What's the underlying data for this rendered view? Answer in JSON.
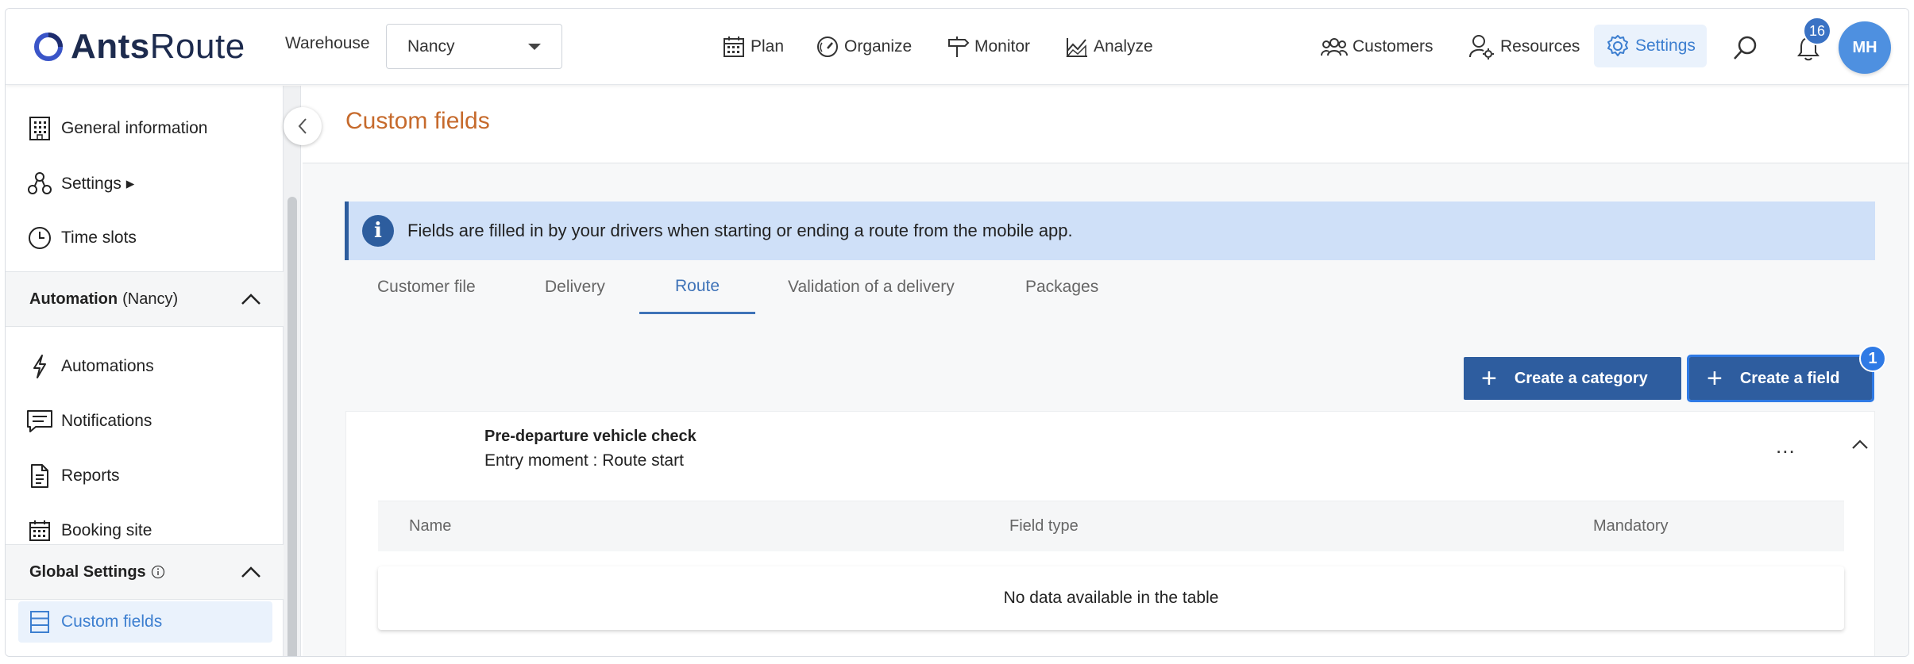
{
  "app": {
    "logo_bold": "Ants",
    "logo_light": "Route"
  },
  "header": {
    "warehouse_label": "Warehouse",
    "warehouse_value": "Nancy",
    "nav": [
      {
        "label": "Plan",
        "icon": "calendar-icon"
      },
      {
        "label": "Organize",
        "icon": "gauge-icon"
      },
      {
        "label": "Monitor",
        "icon": "signpost-icon"
      },
      {
        "label": "Analyze",
        "icon": "chart-icon"
      }
    ],
    "right_nav": [
      {
        "label": "Customers",
        "icon": "users-icon"
      },
      {
        "label": "Resources",
        "icon": "user-gear-icon"
      },
      {
        "label": "Settings",
        "icon": "gear-icon",
        "active": true
      }
    ],
    "notifications_count": "16",
    "avatar_initials": "MH",
    "accent_color": "#3d7fd0"
  },
  "sidebar": {
    "items_top": [
      {
        "label": "General information",
        "icon": "building-icon"
      },
      {
        "label": "Settings ▸",
        "icon": "nodes-icon"
      },
      {
        "label": "Time slots",
        "icon": "clock-icon"
      }
    ],
    "section_automation": {
      "title": "Automation",
      "suffix": "(Nancy)"
    },
    "items_automation": [
      {
        "label": "Automations",
        "icon": "bolt-icon"
      },
      {
        "label": "Notifications",
        "icon": "message-icon"
      },
      {
        "label": "Reports",
        "icon": "document-icon"
      },
      {
        "label": "Booking site",
        "icon": "calendar-grid-icon"
      }
    ],
    "section_global": {
      "title": "Global Settings"
    },
    "items_global": [
      {
        "label": "Custom fields",
        "icon": "fields-icon",
        "active": true
      }
    ]
  },
  "main": {
    "title": "Custom fields",
    "info": "Fields are filled in by your drivers when starting or ending a route from the mobile app.",
    "tabs": [
      {
        "label": "Customer file"
      },
      {
        "label": "Delivery"
      },
      {
        "label": "Route",
        "active": true
      },
      {
        "label": "Validation of a delivery"
      },
      {
        "label": "Packages"
      }
    ],
    "buttons": {
      "create_category": "Create a category",
      "create_field": "Create a field"
    },
    "step_badge": "1",
    "category": {
      "title": "Pre-departure vehicle check",
      "subtitle": "Entry moment : Route start",
      "menu": "..."
    },
    "table": {
      "columns": [
        "Name",
        "Field type",
        "Mandatory"
      ],
      "empty": "No data available in the table"
    }
  }
}
